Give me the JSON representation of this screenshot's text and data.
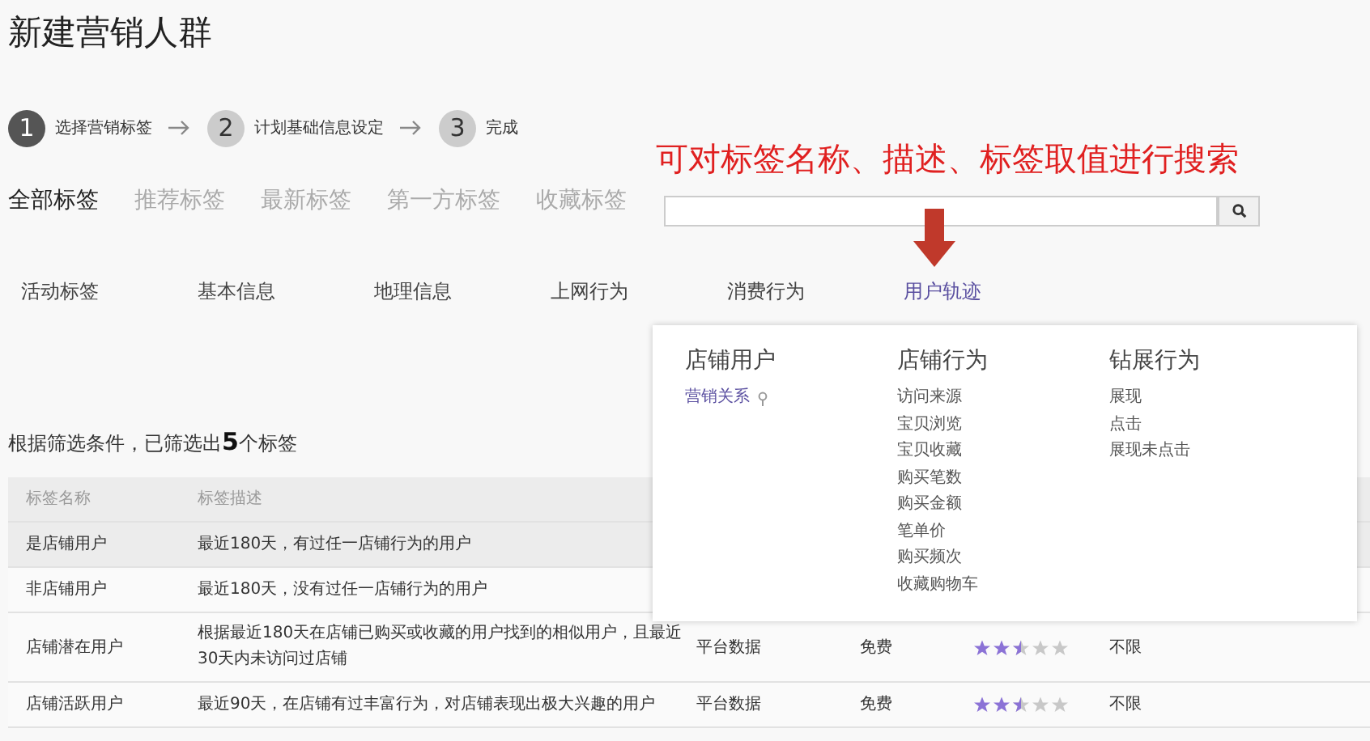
{
  "page_title": "新建营销人群",
  "steps": [
    {
      "number": "1",
      "label": "选择营销标签",
      "active": true
    },
    {
      "number": "2",
      "label": "计划基础信息设定",
      "active": false
    },
    {
      "number": "3",
      "label": "完成",
      "active": false
    }
  ],
  "annotation": "可对标签名称、描述、标签取值进行搜索",
  "tabs": [
    {
      "label": "全部标签",
      "selected": true
    },
    {
      "label": "推荐标签",
      "selected": false
    },
    {
      "label": "最新标签",
      "selected": false
    },
    {
      "label": "第一方标签",
      "selected": false
    },
    {
      "label": "收藏标签",
      "selected": false
    }
  ],
  "categories": [
    {
      "label": "活动标签",
      "selected": false
    },
    {
      "label": "基本信息",
      "selected": false
    },
    {
      "label": "地理信息",
      "selected": false
    },
    {
      "label": "上网行为",
      "selected": false
    },
    {
      "label": "消费行为",
      "selected": false
    },
    {
      "label": "用户轨迹",
      "selected": true
    }
  ],
  "dropdown": {
    "groups": [
      {
        "heading": "店铺用户",
        "items": [
          {
            "label": "营销关系",
            "selected": true
          }
        ]
      },
      {
        "heading": "店铺行为",
        "items": [
          {
            "label": "访问来源",
            "selected": false
          },
          {
            "label": "宝贝浏览",
            "selected": false
          },
          {
            "label": "宝贝收藏",
            "selected": false
          },
          {
            "label": "购买笔数",
            "selected": false
          },
          {
            "label": "购买金额",
            "selected": false
          },
          {
            "label": "笔单价",
            "selected": false
          },
          {
            "label": "购买频次",
            "selected": false
          },
          {
            "label": "收藏购物车",
            "selected": false
          }
        ]
      },
      {
        "heading": "钻展行为",
        "items": [
          {
            "label": "展现",
            "selected": false
          },
          {
            "label": "点击",
            "selected": false
          },
          {
            "label": "展现未点击",
            "selected": false
          }
        ]
      }
    ]
  },
  "result_text": "根据筛选条件，已筛选出**5**个标签",
  "table": {
    "columns": [
      "标签名称",
      "标签描述"
    ],
    "rows": [
      {
        "name": "是店铺用户",
        "description": "最近180天，有过任一店铺行为的用户",
        "selected": true
      },
      {
        "name": "非店铺用户",
        "description": "最近180天，没有过任一店铺行为的用户",
        "selected": false
      },
      {
        "name": "店铺潜在用户",
        "description": "根据最近180天在店铺已购买或收藏的用户找到的相似用户，且最近30天内未访问过店铺",
        "source": "平台数据",
        "price": "免费",
        "stars": 2.5,
        "limit": "不限",
        "selected": false
      },
      {
        "name": "店铺活跃用户",
        "description": "最近90天，在店铺有过丰富行为，对店铺表现出极大兴趣的用户",
        "source": "平台数据",
        "price": "免费",
        "stars": 2.5,
        "limit": "不限",
        "selected": false
      }
    ]
  }
}
